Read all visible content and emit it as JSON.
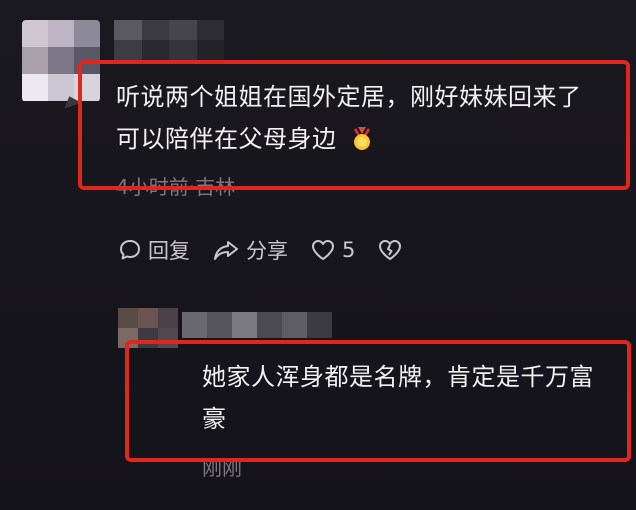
{
  "colors": {
    "background": "#17151d",
    "text": "#f2f2f2",
    "meta": "#7a7882",
    "action": "#c9c7ce",
    "highlight": "#e1261c"
  },
  "comment1": {
    "text_line1": "听说两个姐姐在国外定居，刚好妹妹回来了",
    "text_line2": "可以陪伴在父母身边",
    "emoji": "badge-emoji",
    "meta": "4小时前·吉林",
    "actions": {
      "reply_label": "回复",
      "share_label": "分享",
      "like_count": "5"
    }
  },
  "comment2": {
    "text_line1": "她家人浑身都是名牌，肯定是千万富",
    "text_line2": "豪",
    "meta": "刚刚"
  }
}
